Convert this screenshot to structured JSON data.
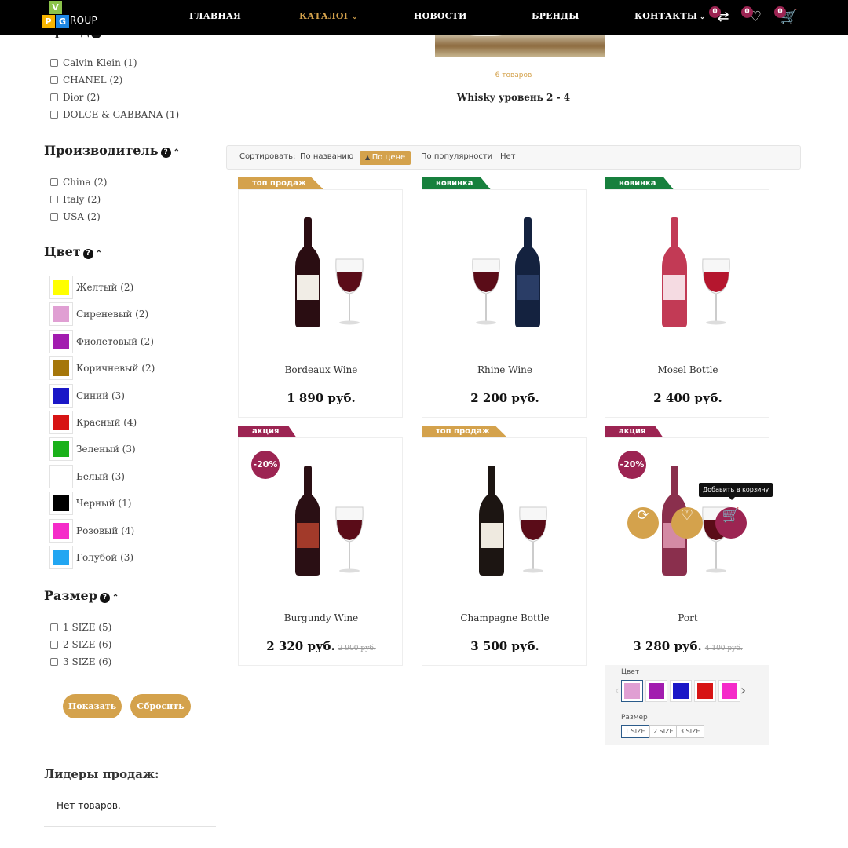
{
  "header": {
    "logo_letters": [
      "V",
      "P",
      "G"
    ],
    "logo_text": "ROUP",
    "nav": [
      "ГЛАВНАЯ",
      "КАТАЛОГ",
      "НОВОСТИ",
      "БРЕНДЫ",
      "КОНТАКТЫ"
    ],
    "compare_count": "0",
    "wishlist_count": "0",
    "cart_count": "0"
  },
  "sidebar": {
    "brand_heading": "Бренд",
    "brands": [
      "Calvin Klein (1)",
      "CHANEL (2)",
      "Dior (2)",
      "DOLCE & GABBANA (1)"
    ],
    "maker_heading": "Производитель",
    "makers": [
      "China (2)",
      "Italy (2)",
      "USA (2)"
    ],
    "color_heading": "Цвет",
    "colors": [
      {
        "label": "Желтый (2)",
        "hex": "#ffff00"
      },
      {
        "label": "Сиреневый (2)",
        "hex": "#e09fd3"
      },
      {
        "label": "Фиолетовый (2)",
        "hex": "#a21caf"
      },
      {
        "label": "Коричневый (2)",
        "hex": "#a5760a"
      },
      {
        "label": "Синий (3)",
        "hex": "#1a17c7"
      },
      {
        "label": "Красный (4)",
        "hex": "#d71414"
      },
      {
        "label": "Зеленый (3)",
        "hex": "#1ab11a"
      },
      {
        "label": "Белый (3)",
        "hex": "#ffffff"
      },
      {
        "label": "Черный (1)",
        "hex": "#000000"
      },
      {
        "label": "Розовый (4)",
        "hex": "#f52bc9"
      },
      {
        "label": "Голубой (3)",
        "hex": "#22a6f2"
      }
    ],
    "size_heading": "Размер",
    "sizes": [
      "1 SIZE (5)",
      "2 SIZE (6)",
      "3 SIZE (6)"
    ],
    "show_button": "Показать",
    "reset_button": "Сбросить",
    "leaders_heading": "Лидеры продаж:",
    "leaders_empty": "Нет товаров."
  },
  "category": {
    "count": "6 товаров",
    "name": "Whisky уровень 2 - 4"
  },
  "sort": {
    "label": "Сортировать:",
    "options": [
      "По названию",
      "По цене",
      "По популярности",
      "Нет"
    ],
    "selected": "По цене"
  },
  "products": [
    {
      "name": "Bordeaux Wine",
      "price": "1 890 руб.",
      "old_price": "",
      "ribbon": "топ продаж",
      "ribbon_color": "#d4a24c",
      "discount": ""
    },
    {
      "name": "Rhine Wine",
      "price": "2 200 руб.",
      "old_price": "",
      "ribbon": "новинка",
      "ribbon_color": "#17803d",
      "discount": ""
    },
    {
      "name": "Mosel Bottle",
      "price": "2 400 руб.",
      "old_price": "",
      "ribbon": "новинка",
      "ribbon_color": "#17803d",
      "discount": ""
    },
    {
      "name": "Burgundy Wine",
      "price": "2 320 руб.",
      "old_price": "2 900 руб.",
      "ribbon": "акция",
      "ribbon_color": "#9c2452",
      "discount": "-20%"
    },
    {
      "name": "Champagne Bottle",
      "price": "3 500 руб.",
      "old_price": "",
      "ribbon": "топ продаж",
      "ribbon_color": "#d4a24c",
      "discount": ""
    },
    {
      "name": "Port",
      "price": "3 280 руб.",
      "old_price": "4 100 руб.",
      "ribbon": "акция",
      "ribbon_color": "#9c2452",
      "discount": "-20%"
    }
  ],
  "hover": {
    "tooltip": "Добавить в корзину",
    "color_label": "Цвет",
    "size_label": "Размер",
    "swatches": [
      "#e09fd3",
      "#a21caf",
      "#1a17c7",
      "#d71414",
      "#f52bc9"
    ],
    "sizes": [
      "1 SIZE",
      "2 SIZE",
      "3 SIZE"
    ]
  },
  "colors": {
    "accent": "#d4a24c",
    "brand_dark": "#9c2452",
    "new_green": "#17803d"
  }
}
